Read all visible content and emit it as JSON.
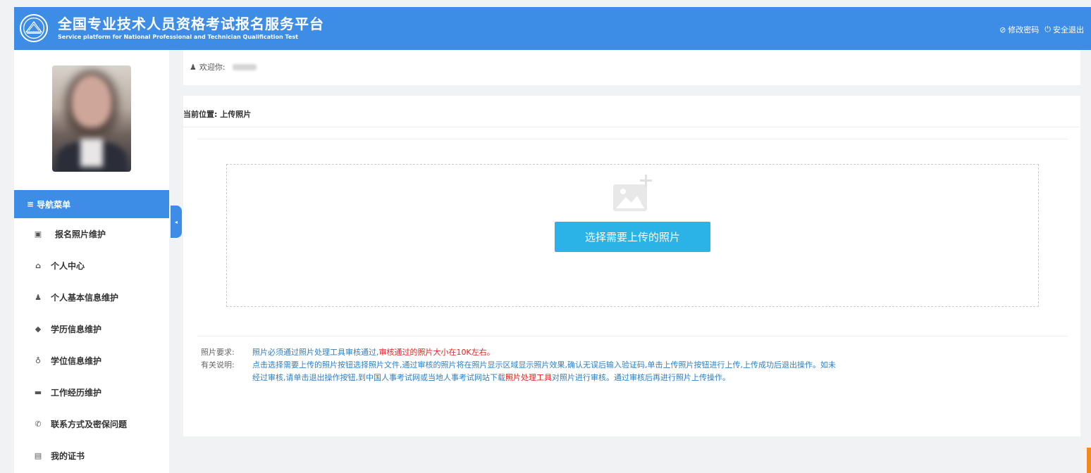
{
  "header": {
    "title": "全国专业技术人员资格考试报名服务平台",
    "subtitle": "Service platform for National Professional and Technician Qualification Test",
    "change_password": "修改密码",
    "logout": "安全退出"
  },
  "welcome": {
    "label": "欢迎你:"
  },
  "nav": {
    "header": "导航菜单",
    "items": [
      {
        "label": "报名照片维护",
        "icon": "picture-icon"
      },
      {
        "label": "个人中心",
        "icon": "home-icon"
      },
      {
        "label": "个人基本信息维护",
        "icon": "user-icon"
      },
      {
        "label": "学历信息维护",
        "icon": "graduation-cap-icon"
      },
      {
        "label": "学位信息维护",
        "icon": "degree-icon"
      },
      {
        "label": "工作经历维护",
        "icon": "briefcase-icon"
      },
      {
        "label": "联系方式及密保问题",
        "icon": "phone-icon"
      },
      {
        "label": "我的证书",
        "icon": "certificate-icon"
      }
    ]
  },
  "main": {
    "breadcrumb_label": "当前位置:",
    "breadcrumb_value": "上传照片",
    "upload_button": "选择需要上传的照片",
    "notes": {
      "req_label": "照片要求:",
      "req_text": "照片必须通过照片处理工具审核通过,",
      "req_red": "审核通过的照片大小在10K左右。",
      "info_label": "有关说明:",
      "info_text_1": "点击选择需要上传的照片按钮选择照片文件,通过审核的照片将在照片显示区域显示照片效果,确认无误后输入验证码,单击上传照片按钮进行上传,上传成功后退出操作。如未",
      "info_text_2a": "经过审核,请单击退出操作按钮,到中国人事考试网或当地人事考试网站下载",
      "info_text_2_red": "照片处理工具",
      "info_text_2b": "对照片进行审核。通过审核后再进行照片上传操作。"
    }
  },
  "colors": {
    "primary": "#3d8ce6",
    "button": "#2bb3e8",
    "note_blue": "#2e7fc4",
    "note_red": "#e8211b"
  }
}
